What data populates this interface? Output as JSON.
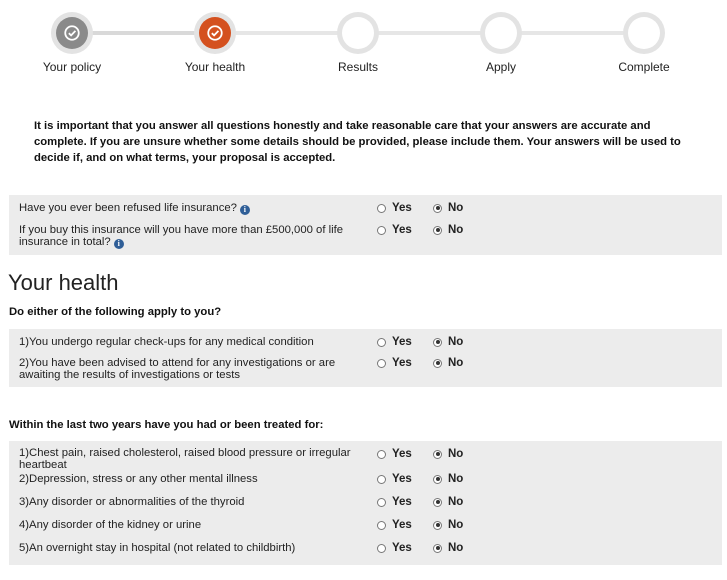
{
  "stepper": {
    "steps": [
      {
        "label": "Your policy",
        "state": "done"
      },
      {
        "label": "Your health",
        "state": "active"
      },
      {
        "label": "Results",
        "state": "pending"
      },
      {
        "label": "Apply",
        "state": "pending"
      },
      {
        "label": "Complete",
        "state": "pending"
      }
    ],
    "colors": {
      "done": "#8a8a8a",
      "active": "#d4511f",
      "pending": "#e3e3e3"
    }
  },
  "intro": "It is important that you answer all questions honestly and take reasonable care that your answers are accurate and complete. If you are unsure whether some details should be provided, please include them. Your answers will be used to decide if, and on what terms, your proposal is accepted.",
  "options": {
    "yes": "Yes",
    "no": "No"
  },
  "general_questions": [
    {
      "text": "Have you ever been refused life insurance?",
      "has_info": true,
      "answer": "No"
    },
    {
      "text": "If you buy this insurance will you have more than £500,000 of life insurance in total?",
      "has_info": true,
      "answer": "No"
    }
  ],
  "health": {
    "heading": "Your health",
    "apply_prompt": "Do either of the following apply to you?",
    "apply_questions": [
      {
        "text": "1)You undergo regular check-ups for any medical condition",
        "answer": "No"
      },
      {
        "text": "2)You have been advised to attend for any investigations or are awaiting the results of investigations or tests",
        "answer": "No"
      }
    ],
    "treated_prompt": "Within the last two years have you had or been treated for:",
    "treated_questions": [
      {
        "text": "1)Chest pain, raised cholesterol, raised blood pressure or irregular heartbeat",
        "answer": "No"
      },
      {
        "text": "2)Depression, stress or any other mental illness",
        "answer": "No"
      },
      {
        "text": "3)Any disorder or abnormalities of the thyroid",
        "answer": "No"
      },
      {
        "text": "4)Any disorder of the kidney or urine",
        "answer": "No"
      },
      {
        "text": "5)An overnight stay in hospital (not related to childbirth)",
        "answer": "No"
      }
    ]
  }
}
